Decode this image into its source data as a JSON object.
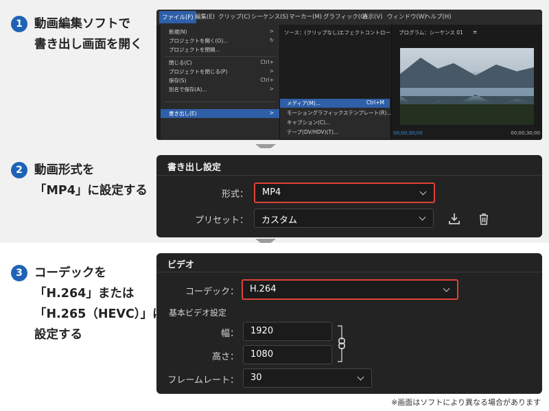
{
  "steps": [
    {
      "number": "1",
      "lines": [
        "動画編集ソフトで",
        "書き出し画面を開く"
      ]
    },
    {
      "number": "2",
      "lines": [
        "動画形式を",
        "「MP4」に設定する"
      ]
    },
    {
      "number": "3",
      "lines": [
        "コーデックを",
        "「H.264」または",
        "「H.265（HEVC）」に",
        "設定する"
      ]
    }
  ],
  "premiere": {
    "menubar": [
      "ファイル(F)",
      "編集(E)",
      "クリップ(C)",
      "シーケンス(S)",
      "マーカー(M)",
      "グラフィック(G)",
      "表示(V)",
      "ウィンドウ(W)",
      "ヘルプ(H)"
    ],
    "file_menu": [
      {
        "label": "新規(N)",
        "shortcut": ">"
      },
      {
        "label": "プロジェクトを開く(O)...",
        "shortcut": "↻"
      },
      {
        "label": "プロジェクトを閉開...",
        "shortcut": ""
      },
      {
        "label": "閉じる(C)",
        "shortcut": "Ctrl+"
      },
      {
        "label": "プロジェクトを閉じる(P)",
        "shortcut": ">"
      },
      {
        "label": "保存(S)",
        "shortcut": "Ctrl+"
      },
      {
        "label": "別名で保存(A)...",
        "shortcut": ">"
      },
      {
        "label": "書き出し(E)",
        "shortcut": ">"
      }
    ],
    "export_submenu": [
      {
        "label": "メディア(M)...",
        "shortcut": "Ctrl+M"
      },
      {
        "label": "モーショングラフィックステンプレート(R)...",
        "shortcut": ""
      },
      {
        "label": "キャプション(C)...",
        "shortcut": ""
      },
      {
        "label": "テープ(DV/HDV)(T)...",
        "shortcut": ""
      }
    ],
    "source_tab": "ソース：(クリップなし)",
    "effect_tab": "エフェクトコントロール",
    "program_tab": "プログラム：シーケンス 01",
    "program_menu_glyph": "≡",
    "timecode_left": "00;00;30;00",
    "timecode_right": "00;00;30;00"
  },
  "export_settings": {
    "title": "書き出し設定",
    "format_label": "形式：",
    "format_value": "MP4",
    "preset_label": "プリセット：",
    "preset_value": "カスタム"
  },
  "video_settings": {
    "title": "ビデオ",
    "codec_label": "コーデック：",
    "codec_value": "H.264",
    "basic_heading": "基本ビデオ設定",
    "width_label": "幅：",
    "width_value": "1920",
    "height_label": "高さ：",
    "height_value": "1080",
    "framerate_label": "フレームレート：",
    "framerate_value": "30"
  },
  "footnote": "※画面はソフトにより異なる場合があります",
  "colors": {
    "step_badge": "#1e63b6",
    "highlight_border": "#e0423a",
    "menu_highlight": "#2e5fa8"
  }
}
